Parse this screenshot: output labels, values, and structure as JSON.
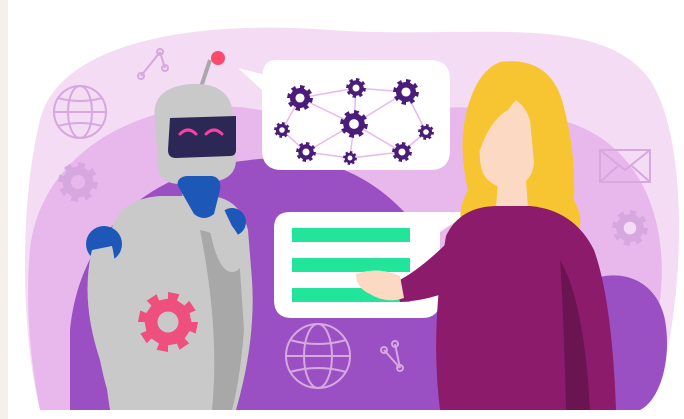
{
  "scene": {
    "description_free": true,
    "palette": {
      "backdrop_light": "#f3dcf4",
      "backdrop_mid": "#e8b8ec",
      "backdrop_purple": "#9a4fc3",
      "robot_body": "#c9c9c9",
      "robot_shadow": "#a8a8a8",
      "robot_visor": "#2b2856",
      "robot_eyes": "#ff3ea5",
      "robot_joint": "#1d58b8",
      "robot_gear": "#ef4f7c",
      "antenna_tip": "#ff4a6b",
      "bubble": "#ffffff",
      "network_gear": "#4a1d7a",
      "text_lines": "#22e49b",
      "hair": "#f7c532",
      "skin": "#fcd9c2",
      "sweater": "#8c1b6c",
      "sweater_shadow": "#6a1452",
      "line_icons": "#d7a7df"
    },
    "icons": [
      "globe-icon",
      "gear-icon",
      "share-icon",
      "envelope-icon",
      "network-icon"
    ],
    "text_lines_count": 3,
    "network_nodes": 9
  }
}
